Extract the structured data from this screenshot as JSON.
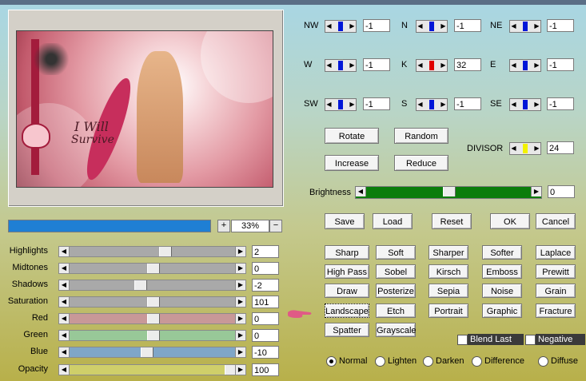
{
  "preview": {
    "caption_line1": "I Will",
    "caption_line2": "Survive"
  },
  "zoom": {
    "value": "33%",
    "plus": "+",
    "minus": "−",
    "progress_pct": 100
  },
  "sliders": [
    {
      "label": "Highlights",
      "value": "2",
      "pos": 0.58,
      "color": "#a9a9a9"
    },
    {
      "label": "Midtones",
      "value": "0",
      "pos": 0.5,
      "color": "#a9a9a9"
    },
    {
      "label": "Shadows",
      "value": "-2",
      "pos": 0.42,
      "color": "#a9a9a9"
    },
    {
      "label": "Saturation",
      "value": "101",
      "pos": 0.5,
      "color": "#a9a9a9"
    },
    {
      "label": "Red",
      "value": "0",
      "pos": 0.5,
      "color": "#c89898"
    },
    {
      "label": "Green",
      "value": "0",
      "pos": 0.5,
      "color": "#98c898"
    },
    {
      "label": "Blue",
      "value": "-10",
      "pos": 0.46,
      "color": "#7fa6c8"
    },
    {
      "label": "Opacity",
      "value": "100",
      "pos": 1.0,
      "color": "#cfcf6a"
    }
  ],
  "matrix": [
    {
      "label": "NW",
      "value": "-1",
      "color": "#0016d8"
    },
    {
      "label": "N",
      "value": "-1",
      "color": "#0016d8"
    },
    {
      "label": "NE",
      "value": "-1",
      "color": "#0016d8"
    },
    {
      "label": "W",
      "value": "-1",
      "color": "#0016d8"
    },
    {
      "label": "K",
      "value": "32",
      "color": "#e00000"
    },
    {
      "label": "E",
      "value": "-1",
      "color": "#0016d8"
    },
    {
      "label": "SW",
      "value": "-1",
      "color": "#0016d8"
    },
    {
      "label": "S",
      "value": "-1",
      "color": "#0016d8"
    },
    {
      "label": "SE",
      "value": "-1",
      "color": "#0016d8"
    }
  ],
  "divisor": {
    "label": "DIVISOR",
    "value": "24",
    "color": "#f2f200"
  },
  "actions": {
    "rotate": "Rotate",
    "random": "Random",
    "increase": "Increase",
    "reduce": "Reduce"
  },
  "brightness": {
    "label": "Brightness",
    "value": "0",
    "pos": 0.5
  },
  "file_buttons": {
    "save": "Save",
    "load": "Load",
    "reset": "Reset",
    "ok": "OK",
    "cancel": "Cancel"
  },
  "presets": [
    [
      "Sharp",
      "Soft",
      "Sharper",
      "Softer",
      "Laplace"
    ],
    [
      "High Pass",
      "Sobel",
      "Kirsch",
      "Emboss",
      "Prewitt"
    ],
    [
      "Draw",
      "Posterize",
      "Sepia",
      "Noise",
      "Grain"
    ],
    [
      "Landscape",
      "Etch",
      "Portrait",
      "Graphic",
      "Fracture"
    ],
    [
      "Spatter",
      "Grayscale"
    ]
  ],
  "options": {
    "blend_last": "Blend Last",
    "negative": "Negative"
  },
  "modes": [
    "Normal",
    "Lighten",
    "Darken",
    "Difference",
    "Diffuse"
  ],
  "selected_mode": "Normal"
}
